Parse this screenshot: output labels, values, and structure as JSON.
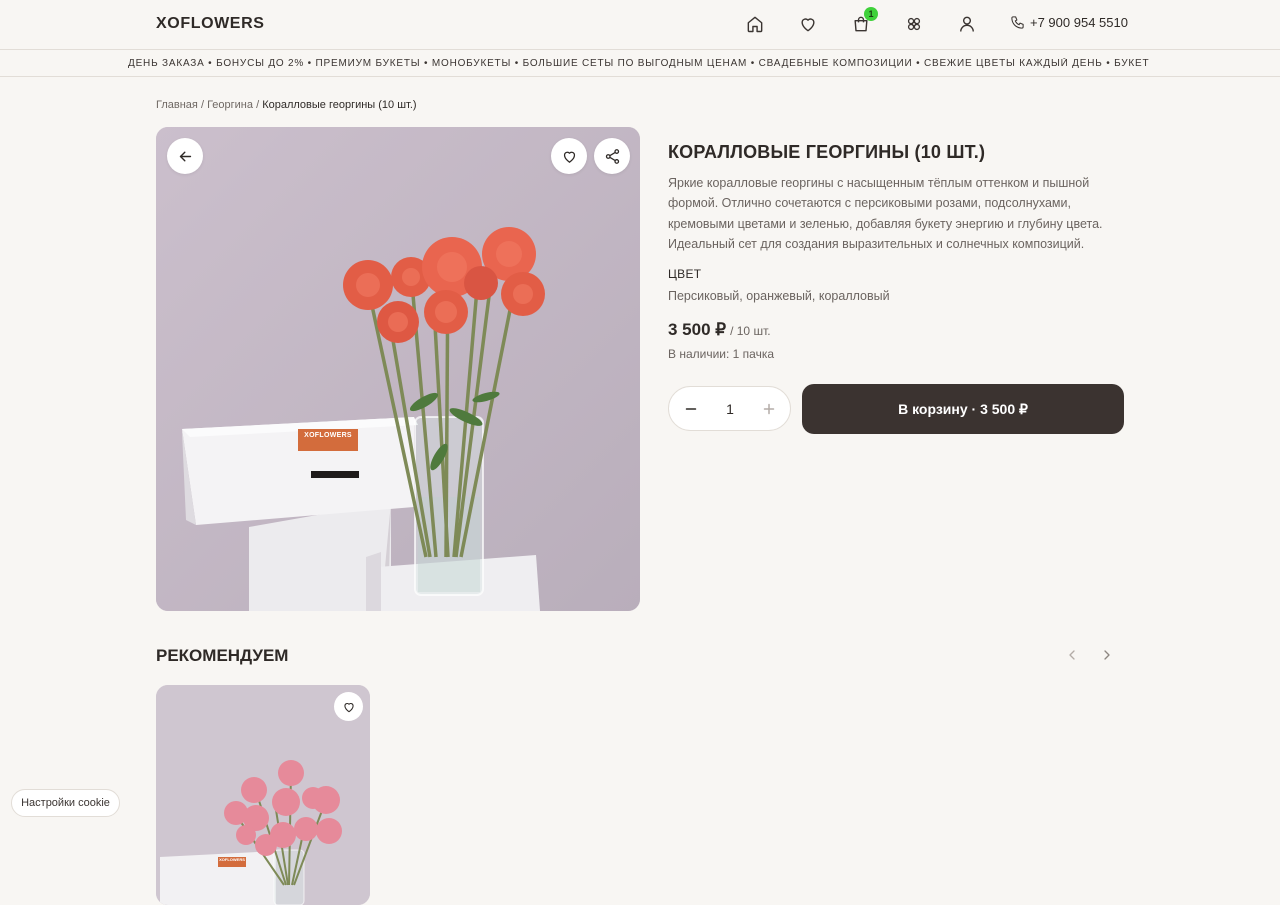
{
  "header": {
    "logo": "XOFLOWERS",
    "cart_count": "1",
    "phone": "+7 900 954 5510",
    "icons": [
      "home-icon",
      "heart-icon",
      "cart-icon",
      "flower-icon",
      "user-icon",
      "phone-icon"
    ]
  },
  "marquee": {
    "text": "ДЕНЬ ЗАКАЗА • БОНУСЫ ДО 2% • ПРЕМИУМ БУКЕТЫ • МОНОБУКЕТЫ • БОЛЬШИЕ СЕТЫ ПО ВЫГОДНЫМ ЦЕНАМ • СВАДЕБНЫЕ КОМПОЗИЦИИ • СВЕЖИЕ ЦВЕТЫ КАЖДЫЙ ДЕНЬ • БУКЕТ"
  },
  "breadcrumb": {
    "home": "Главная",
    "separator": "/",
    "category": "Георгина",
    "current": "Коралловые георгины (10 шт.)"
  },
  "product": {
    "title": "КОРАЛЛОВЫЕ ГЕОРГИНЫ (10 ШТ.)",
    "description": "Яркие коралловые георгины с насыщенным тёплым оттенком и пышной формой. Отлично сочетаются с персиковыми розами, подсолнухами, кремовыми цветами и зеленью, добавляя букету энергию и глубину цвета. Идеальный сет для создания выразительных и солнечных композиций.",
    "color_label": "ЦВЕТ",
    "color_value": "Персиковый, оранжевый, коралловый",
    "price": "3 500 ₽",
    "per_unit": "/ 10 шт.",
    "stock": "В наличии: 1 пачка",
    "quantity": "1",
    "add_to_cart": "В корзину · 3 500 ₽",
    "box_label": "XOFLOWERS"
  },
  "recommendations": {
    "title": "РЕКОМЕНДУЕМ",
    "card_box_label": "XOFLOWERS"
  },
  "cookie": {
    "label": "Настройки cookie"
  },
  "colors": {
    "background": "#f8f6f3",
    "text_dark": "#2f2a27",
    "button_dark": "#3b3330",
    "cart_badge": "#3fd13a",
    "flower_coral": "#e9654f",
    "flower_pink": "#e68a9a"
  }
}
